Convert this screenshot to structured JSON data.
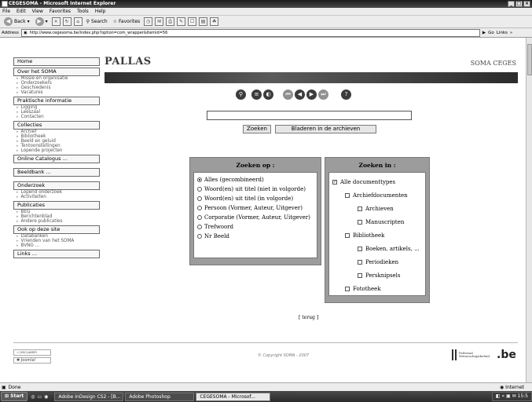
{
  "window": {
    "title": "CEGESOMA - Microsoft Internet Explorer"
  },
  "menu": [
    "File",
    "Edit",
    "View",
    "Favorites",
    "Tools",
    "Help"
  ],
  "toolbar": {
    "back": "Back",
    "search": "Search",
    "favorites": "Favorites"
  },
  "address": {
    "label": "Address",
    "url": "http://www.cegesoma.be/index.php?option=com_wrapper&Itemid=56",
    "go": "Go",
    "links": "Links"
  },
  "sidebar": [
    {
      "label": "Home",
      "children": []
    },
    {
      "label": "Over het SOMA",
      "children": [
        "Missie en organisatie",
        "Onderzoekers",
        "Geschiedenis",
        "Vacatures"
      ]
    },
    {
      "label": "Praktische informatie",
      "children": [
        "Ligging",
        "Leeszaal",
        "Contacten"
      ]
    },
    {
      "label": "Collecties",
      "children": [
        "Archief",
        "Bibliotheek",
        "Beeld en geluid",
        "Tentoonstellingen",
        "Lopende projecten"
      ]
    },
    {
      "label": "Online Catalogus ...",
      "children": []
    },
    {
      "label": "Beeldbank ...",
      "children": []
    },
    {
      "label": "Onderzoek",
      "children": [
        "Lopend onderzoek",
        "Activiteiten"
      ]
    },
    {
      "label": "Publicaties",
      "children": [
        "BEG",
        "Berichtenblad",
        "Andere publicaties"
      ]
    },
    {
      "label": "Ook op deze site",
      "children": [
        "Databanken",
        "Vrienden van het SOMA",
        "BVNG ..."
      ]
    },
    {
      "label": "Links ...",
      "children": []
    }
  ],
  "header": {
    "logo": "PALLAS",
    "brand": "SOMA CEGES"
  },
  "search": {
    "submit": "Zoeken",
    "browse": "Bladeren in de archieven",
    "query": ""
  },
  "zoeken_op": {
    "title": "Zoeken op :",
    "selected_index": 0,
    "options": [
      "Alles (gecombineerd)",
      "Woord(en) uit titel (niet in volgorde)",
      "Woord(en) uit titel (in volgorde)",
      "Persoon (Vormer, Auteur, Uitgever)",
      "Corporatie (Vormer, Auteur, Uitgever)",
      "Trefwoord",
      "Nr Beeld"
    ]
  },
  "zoeken_in": {
    "title": "Zoeken in :",
    "options": [
      {
        "label": "Alle documenttypes",
        "level": 0,
        "checked": true
      },
      {
        "label": "Archiefdocumenten",
        "level": 1,
        "checked": false
      },
      {
        "label": "Archieven",
        "level": 2,
        "checked": false
      },
      {
        "label": "Manuscripten",
        "level": 2,
        "checked": false
      },
      {
        "label": "Bibliotheek",
        "level": 1,
        "checked": false
      },
      {
        "label": "Boeken, artikels, ...",
        "level": 2,
        "checked": false
      },
      {
        "label": "Periodieken",
        "level": 2,
        "checked": false
      },
      {
        "label": "Persknipsels",
        "level": 2,
        "checked": false
      },
      {
        "label": "Fototheek",
        "level": 1,
        "checked": false
      }
    ]
  },
  "terug": "[ terug ]",
  "footer": {
    "disclaimer": "DISCLAIMER",
    "joomla": "Joomla!",
    "copyright": "© Copyright SOMA - 2007",
    "federal": "Federaal Wetenschapsbeleid",
    "be": ".be"
  },
  "status": {
    "text": "Done",
    "zone": "Internet"
  },
  "taskbar": {
    "start": "Start",
    "tasks": [
      "Adobe InDesign CS2 - [B...",
      "Adobe Photoshop",
      "CEGESOMA - Microsof..."
    ],
    "active_index": 2,
    "clock": "15:5"
  }
}
